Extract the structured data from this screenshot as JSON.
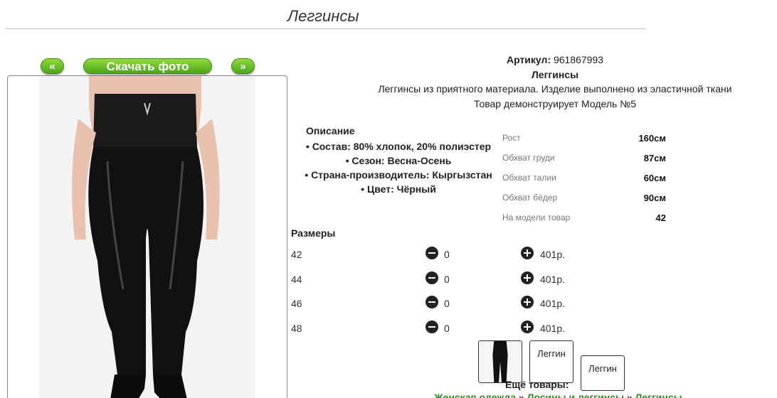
{
  "page": {
    "title": "Леггинсы"
  },
  "nav": {
    "prev_label": "«",
    "download_label": "Скачать фото",
    "next_label": "»"
  },
  "product": {
    "article_label": "Артикул:",
    "article_value": "961867993",
    "name": "Леггинсы",
    "description": "Леггинсы из приятного материала. Изделие выполнено из эластичной ткани",
    "model_note": "Товар демонструирует Модель №5"
  },
  "details": {
    "heading": "Описание",
    "items": [
      "Состав: 80% хлопок, 20% полиэстер",
      "Сезон: Весна-Осень",
      "Страна-производитель: Кыргызстан",
      "Цвет: Чёрный"
    ]
  },
  "measurements": [
    {
      "label": "Рост",
      "value": "160см"
    },
    {
      "label": "Обхват груди",
      "value": "87см"
    },
    {
      "label": "Обхват талии",
      "value": "60см"
    },
    {
      "label": "Обхват бёдер",
      "value": "90см"
    },
    {
      "label": "На модели товар",
      "value": "42"
    }
  ],
  "sizes": {
    "heading": "Размеры",
    "rows": [
      {
        "size": "42",
        "qty": "0",
        "price": "401р."
      },
      {
        "size": "44",
        "qty": "0",
        "price": "401р."
      },
      {
        "size": "46",
        "qty": "0",
        "price": "401р."
      },
      {
        "size": "48",
        "qty": "0",
        "price": "401р."
      }
    ]
  },
  "thumbnails": [
    {
      "label": ""
    },
    {
      "label": "Леггин"
    },
    {
      "label": "Леггин"
    }
  ],
  "more": {
    "heading": "Ещё товары:",
    "breadcrumb": [
      "Женская одежда",
      "Лосины и леггинсы",
      "Леггинсы"
    ],
    "separator": "»"
  },
  "colors": {
    "button_green": "#5cb526",
    "link_green": "#2d8f1b",
    "icon_dark": "#222222"
  },
  "icons": {
    "minus": "minus-circle-icon",
    "plus": "plus-circle-icon"
  }
}
